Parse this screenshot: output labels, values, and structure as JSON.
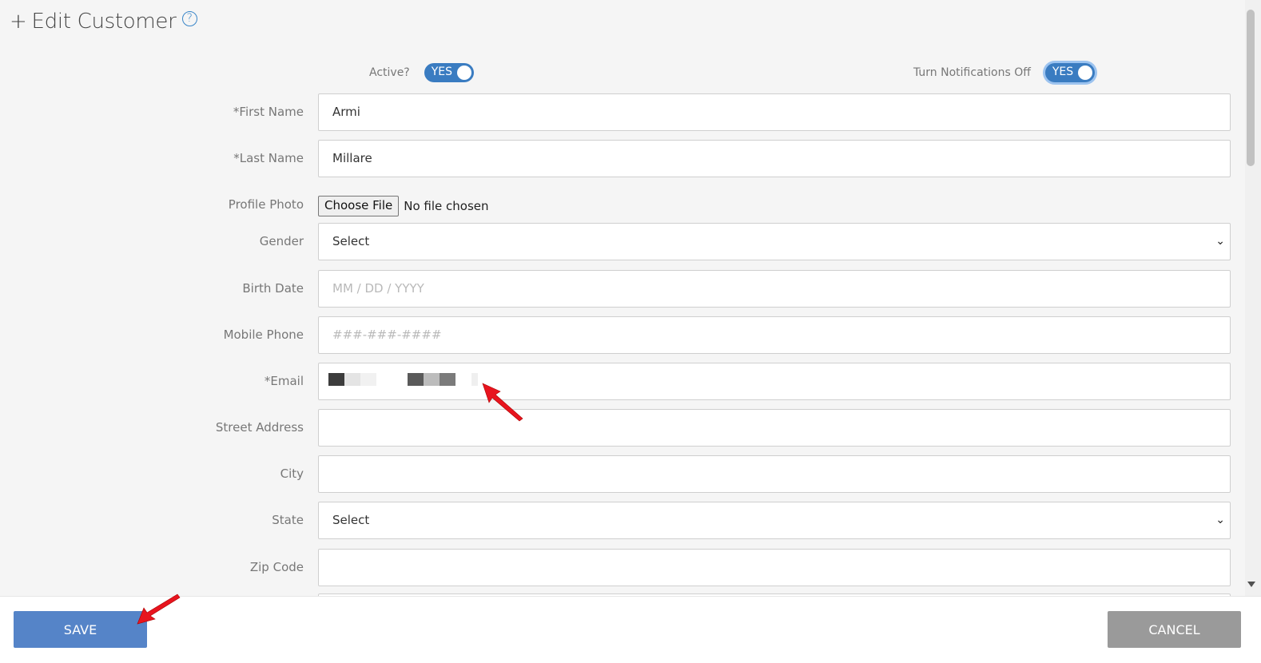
{
  "header": {
    "plus": "+",
    "title": "Edit Customer",
    "help_icon": "question-circle-icon",
    "help_glyph": "?"
  },
  "toggles": {
    "active": {
      "label": "Active?",
      "state": "YES"
    },
    "notifications": {
      "label": "Turn Notifications Off",
      "state": "YES"
    }
  },
  "form": {
    "first_name": {
      "label": "*First Name",
      "value": "Armi"
    },
    "last_name": {
      "label": "*Last Name",
      "value": "Millare"
    },
    "profile_photo": {
      "label": "Profile Photo",
      "button": "Choose File",
      "status": "No file chosen"
    },
    "gender": {
      "label": "Gender",
      "value": "Select"
    },
    "birth_date": {
      "label": "Birth Date",
      "placeholder": "MM / DD / YYYY"
    },
    "mobile_phone": {
      "label": "Mobile Phone",
      "placeholder": "###-###-####"
    },
    "email": {
      "label": "*Email",
      "value": ""
    },
    "street_address": {
      "label": "Street Address",
      "value": ""
    },
    "city": {
      "label": "City",
      "value": ""
    },
    "state": {
      "label": "State",
      "value": "Select"
    },
    "zip_code": {
      "label": "Zip Code",
      "value": ""
    }
  },
  "footer": {
    "save_label": "SAVE",
    "cancel_label": "CANCEL"
  },
  "colors": {
    "accent": "#3a7cc1",
    "save": "#5584c8",
    "cancel": "#9a9a9a",
    "annotation": "#e8141e"
  }
}
